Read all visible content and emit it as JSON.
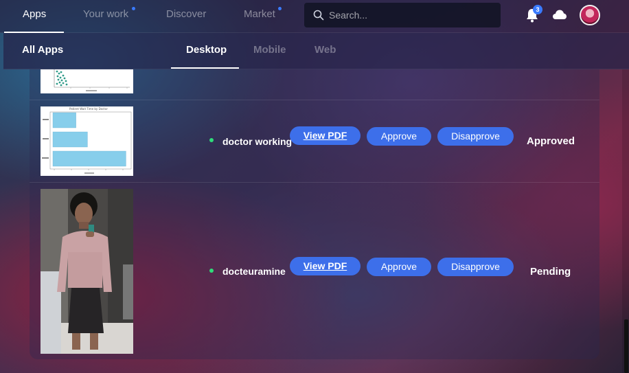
{
  "topnav": {
    "tabs": [
      {
        "label": "Apps",
        "active": true,
        "dot": false
      },
      {
        "label": "Your work",
        "active": false,
        "dot": true
      },
      {
        "label": "Discover",
        "active": false,
        "dot": false
      },
      {
        "label": "Market",
        "active": false,
        "dot": true
      }
    ],
    "search_placeholder": "Search...",
    "notification_count": "3",
    "icons": [
      "search-icon",
      "bell-icon",
      "cloud-icon",
      "avatar"
    ]
  },
  "subnav": {
    "title": "All Apps",
    "tabs": [
      {
        "label": "Desktop",
        "active": true
      },
      {
        "label": "Mobile",
        "active": false
      },
      {
        "label": "Web",
        "active": false
      }
    ]
  },
  "rows": [
    {
      "thumbnail": "scatter-chart",
      "chart_title": "Patient Wait Time by Doctor",
      "chart_values": [
        6,
        9,
        19
      ],
      "name": "doctor working",
      "online": true,
      "view_label": "View PDF",
      "approve_label": "Approve",
      "disapprove_label": "Disapprove",
      "status": "Approved"
    },
    {
      "thumbnail": "person-photo",
      "name": "docteuramine",
      "online": true,
      "view_label": "View PDF",
      "approve_label": "Approve",
      "disapprove_label": "Disapprove",
      "status": "Pending"
    }
  ],
  "colors": {
    "accent": "#3d6fea",
    "online": "#2fdc7a",
    "badge": "#3a7bff"
  }
}
